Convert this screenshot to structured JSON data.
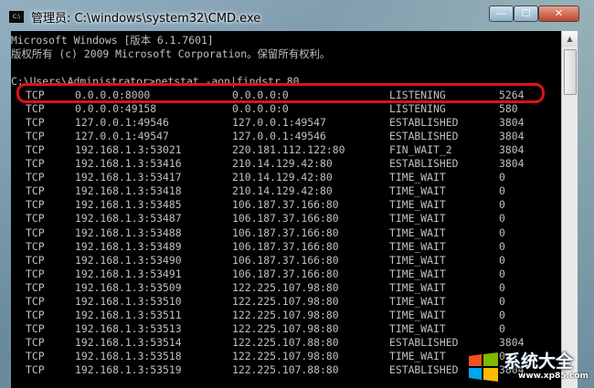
{
  "window": {
    "title": "管理员: C:\\windows\\system32\\CMD.exe",
    "icon_label": "C:\\",
    "minimize_icon": "minimize-icon",
    "maximize_icon": "maximize-icon",
    "close_icon": "close-icon"
  },
  "controls": {
    "min": "—",
    "max": "☐",
    "close": "✕"
  },
  "console": {
    "header_lines": [
      "Microsoft Windows [版本 6.1.7601]",
      "版权所有 (c) 2009 Microsoft Corporation。保留所有权利。",
      "",
      "C:\\Users\\Administrator>netstat -aon|findstr 80"
    ],
    "rows": [
      [
        "TCP",
        "0.0.0.0:8000",
        "0.0.0.0:0",
        "LISTENING",
        "5264"
      ],
      [
        "TCP",
        "0.0.0.0:49158",
        "0.0.0.0:0",
        "LISTENING",
        "580"
      ],
      [
        "TCP",
        "127.0.0.1:49546",
        "127.0.0.1:49547",
        "ESTABLISHED",
        "3804"
      ],
      [
        "TCP",
        "127.0.0.1:49547",
        "127.0.0.1:49546",
        "ESTABLISHED",
        "3804"
      ],
      [
        "TCP",
        "192.168.1.3:53021",
        "220.181.112.122:80",
        "FIN_WAIT_2",
        "3804"
      ],
      [
        "TCP",
        "192.168.1.3:53416",
        "210.14.129.42:80",
        "ESTABLISHED",
        "3804"
      ],
      [
        "TCP",
        "192.168.1.3:53417",
        "210.14.129.42:80",
        "TIME_WAIT",
        "0"
      ],
      [
        "TCP",
        "192.168.1.3:53418",
        "210.14.129.42:80",
        "TIME_WAIT",
        "0"
      ],
      [
        "TCP",
        "192.168.1.3:53485",
        "106.187.37.166:80",
        "TIME_WAIT",
        "0"
      ],
      [
        "TCP",
        "192.168.1.3:53487",
        "106.187.37.166:80",
        "TIME_WAIT",
        "0"
      ],
      [
        "TCP",
        "192.168.1.3:53488",
        "106.187.37.166:80",
        "TIME_WAIT",
        "0"
      ],
      [
        "TCP",
        "192.168.1.3:53489",
        "106.187.37.166:80",
        "TIME_WAIT",
        "0"
      ],
      [
        "TCP",
        "192.168.1.3:53490",
        "106.187.37.166:80",
        "TIME_WAIT",
        "0"
      ],
      [
        "TCP",
        "192.168.1.3:53491",
        "106.187.37.166:80",
        "TIME_WAIT",
        "0"
      ],
      [
        "TCP",
        "192.168.1.3:53509",
        "122.225.107.98:80",
        "TIME_WAIT",
        "0"
      ],
      [
        "TCP",
        "192.168.1.3:53510",
        "122.225.107.98:80",
        "TIME_WAIT",
        "0"
      ],
      [
        "TCP",
        "192.168.1.3:53511",
        "122.225.107.98:80",
        "TIME_WAIT",
        "0"
      ],
      [
        "TCP",
        "192.168.1.3:53513",
        "122.225.107.98:80",
        "TIME_WAIT",
        "0"
      ],
      [
        "TCP",
        "192.168.1.3:53514",
        "122.225.107.88:80",
        "ESTABLISHED",
        "3804"
      ],
      [
        "TCP",
        "192.168.1.3:53518",
        "122.225.107.98:80",
        "TIME_WAIT",
        "0"
      ],
      [
        "TCP",
        "192.168.1.3:53519",
        "122.225.107.88:80",
        "ESTABLISHED",
        "3804"
      ]
    ]
  },
  "watermark": {
    "name": "系统大全",
    "url": "www.xp85.com"
  },
  "colors": {
    "console_bg": "#000000",
    "console_text": "#c0c0c0",
    "highlight": "#e0101a"
  }
}
